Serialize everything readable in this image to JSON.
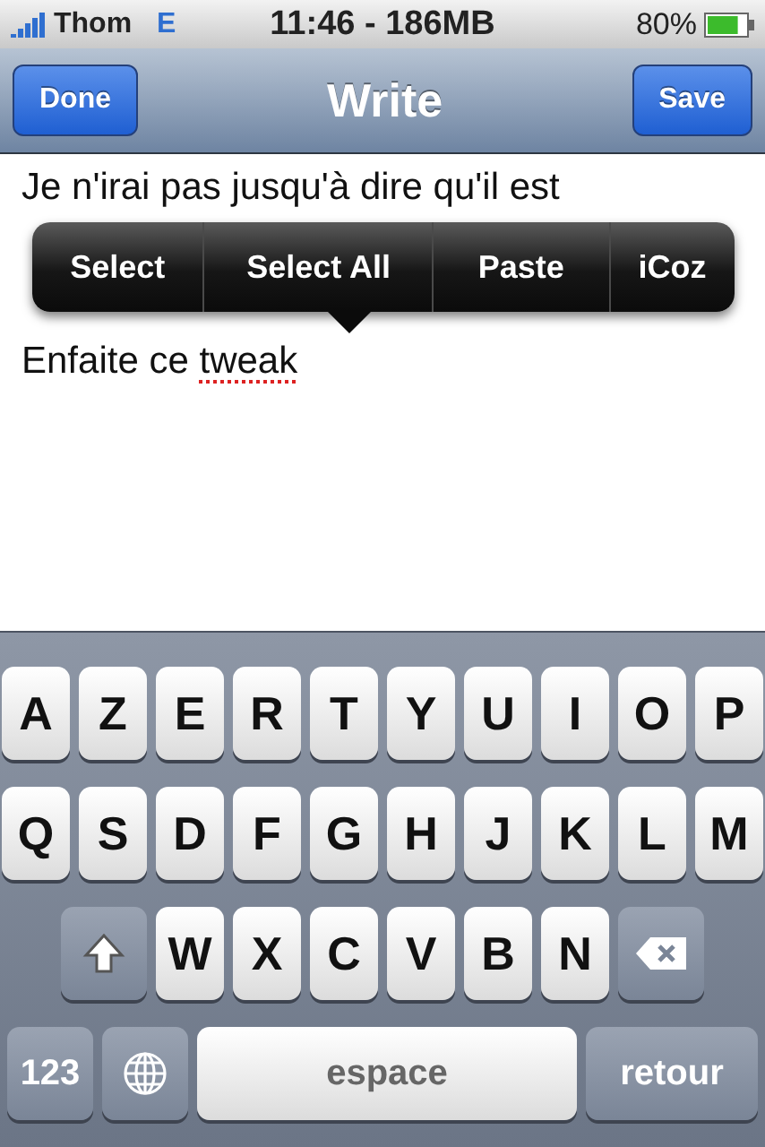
{
  "status_bar": {
    "carrier": "Thom",
    "network": "E",
    "time": "11:46 - 186MB",
    "battery": "80%"
  },
  "nav_bar": {
    "left_button": "Done",
    "title": "Write",
    "right_button": "Save"
  },
  "editor": {
    "paragraphs": [
      {
        "segments": [
          {
            "text": "Je n'irai pas jusqu'à dire qu'il est",
            "misspelled": false
          }
        ]
      },
      {
        "segments": [
          {
            "text": "Enfaite ce ",
            "misspelled": false
          },
          {
            "text": "tweak",
            "misspelled": true
          }
        ]
      }
    ]
  },
  "edit_menu": {
    "items": [
      "Select",
      "Select All",
      "Paste",
      "iCoz"
    ]
  },
  "keyboard": {
    "rows": [
      {
        "keys": [
          {
            "kind": "letter",
            "label": "A"
          },
          {
            "kind": "letter",
            "label": "Z"
          },
          {
            "kind": "letter",
            "label": "E"
          },
          {
            "kind": "letter",
            "label": "R"
          },
          {
            "kind": "letter",
            "label": "T"
          },
          {
            "kind": "letter",
            "label": "Y"
          },
          {
            "kind": "letter",
            "label": "U"
          },
          {
            "kind": "letter",
            "label": "I"
          },
          {
            "kind": "letter",
            "label": "O"
          },
          {
            "kind": "letter",
            "label": "P"
          }
        ]
      },
      {
        "keys": [
          {
            "kind": "letter",
            "label": "Q"
          },
          {
            "kind": "letter",
            "label": "S"
          },
          {
            "kind": "letter",
            "label": "D"
          },
          {
            "kind": "letter",
            "label": "F"
          },
          {
            "kind": "letter",
            "label": "G"
          },
          {
            "kind": "letter",
            "label": "H"
          },
          {
            "kind": "letter",
            "label": "J"
          },
          {
            "kind": "letter",
            "label": "K"
          },
          {
            "kind": "letter",
            "label": "L"
          },
          {
            "kind": "letter",
            "label": "M"
          }
        ]
      },
      {
        "keys": [
          {
            "kind": "shift"
          },
          {
            "kind": "letter",
            "label": "W"
          },
          {
            "kind": "letter",
            "label": "X"
          },
          {
            "kind": "letter",
            "label": "C"
          },
          {
            "kind": "letter",
            "label": "V"
          },
          {
            "kind": "letter",
            "label": "B"
          },
          {
            "kind": "letter",
            "label": "N"
          },
          {
            "kind": "backspace"
          }
        ]
      },
      {
        "keys": [
          {
            "kind": "mode",
            "label": "123"
          },
          {
            "kind": "globe"
          },
          {
            "kind": "space",
            "label": "espace"
          },
          {
            "kind": "return",
            "label": "retour"
          }
        ]
      }
    ]
  }
}
